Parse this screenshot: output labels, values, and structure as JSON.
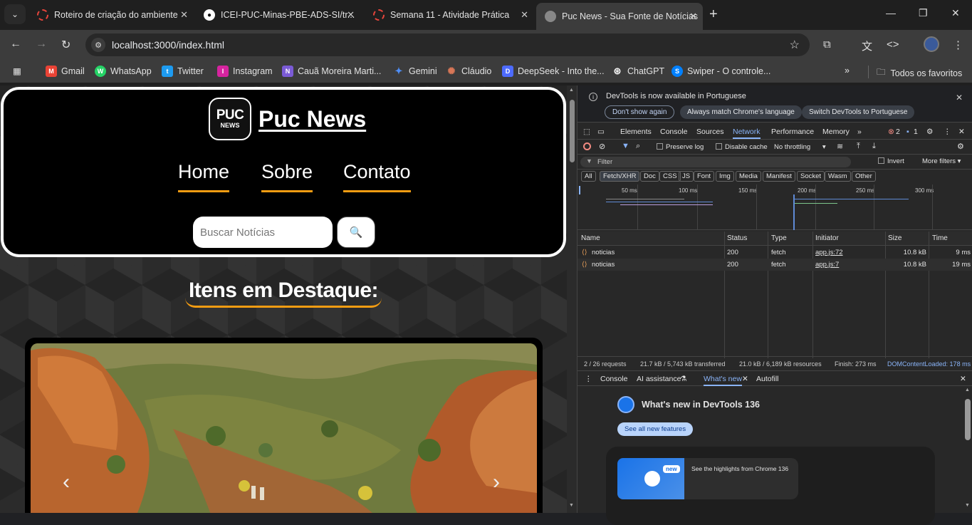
{
  "tabs": [
    {
      "title": "Roteiro de criação do ambiente",
      "icon": "loading-ring-icon"
    },
    {
      "title": "ICEI-PUC-Minas-PBE-ADS-SI/tr...",
      "icon": "github-icon"
    },
    {
      "title": "Semana 11 - Atividade Prática",
      "icon": "loading-ring-icon"
    },
    {
      "title": "Puc News - Sua Fonte de Notícias",
      "icon": "globe-icon",
      "active": true
    }
  ],
  "address_bar": {
    "url": "localhost:3000/index.html"
  },
  "bookmarks": [
    {
      "label": "Gmail",
      "color": "#ea4335",
      "glyph": "M"
    },
    {
      "label": "WhatsApp",
      "color": "#25d366",
      "glyph": "W"
    },
    {
      "label": "Twitter",
      "color": "#1d9bf0",
      "glyph": "t"
    },
    {
      "label": "Instagram",
      "color": "#d6249f",
      "glyph": "I"
    },
    {
      "label": "Cauã Moreira Marti...",
      "color": "#7b5bd6",
      "glyph": "N"
    },
    {
      "label": "Gemini",
      "color": "#4f8ff7",
      "glyph": "✦"
    },
    {
      "label": "Cláudio",
      "color": "#d97757",
      "glyph": "✺"
    },
    {
      "label": "DeepSeek - Into the...",
      "color": "#4d6bfe",
      "glyph": "D"
    },
    {
      "label": "ChatGPT",
      "color": "#555555",
      "glyph": "⊛"
    },
    {
      "label": "Swiper - O controle...",
      "color": "#0080ff",
      "glyph": "S"
    }
  ],
  "all_bookmarks_label": "Todos os favoritos",
  "site": {
    "logo_line1": "PUC",
    "logo_line2": "NEWS",
    "title": "Puc News",
    "nav": [
      "Home",
      "Sobre",
      "Contato"
    ],
    "search_placeholder": "Buscar Notícias",
    "featured_title": "Itens em Destaque:",
    "accent_color": "#f39c12"
  },
  "devtools": {
    "info_message": "DevTools is now available in Portuguese",
    "info_buttons": [
      "Don't show again",
      "Always match Chrome's language",
      "Switch DevTools to Portuguese"
    ],
    "panels": [
      "Elements",
      "Console",
      "Sources",
      "Network",
      "Performance",
      "Memory"
    ],
    "active_panel": "Network",
    "error_count": "2",
    "message_count": "1",
    "preserve_log": "Preserve log",
    "disable_cache": "Disable cache",
    "throttling": "No throttling",
    "filter_placeholder": "Filter",
    "invert": "Invert",
    "more_filters": "More filters",
    "type_filters": [
      "All",
      "Fetch/XHR",
      "Doc",
      "CSS",
      "JS",
      "Font",
      "Img",
      "Media",
      "Manifest",
      "Socket",
      "Wasm",
      "Other"
    ],
    "selected_type": "Fetch/XHR",
    "timeline_ticks": [
      "50 ms",
      "100 ms",
      "150 ms",
      "200 ms",
      "250 ms",
      "300 ms"
    ],
    "columns": [
      "Name",
      "Status",
      "Type",
      "Initiator",
      "Size",
      "Time"
    ],
    "requests": [
      {
        "name": "noticias",
        "status": "200",
        "type": "fetch",
        "initiator": "app.js:72",
        "size": "10.8 kB",
        "time": "9 ms"
      },
      {
        "name": "noticias",
        "status": "200",
        "type": "fetch",
        "initiator": "app.js:7",
        "size": "10.8 kB",
        "time": "19 ms"
      }
    ],
    "status_summary": [
      "2 / 26 requests",
      "21.7 kB / 5,743 kB transferred",
      "21.0 kB / 6,189 kB resources",
      "Finish: 273 ms",
      "DOMContentLoaded: 178 ms"
    ],
    "drawer_tabs": [
      "Console",
      "AI assistance",
      "What's new",
      "Autofill"
    ],
    "whats_new_title": "What's new in DevTools 136",
    "see_all_label": "See all new features",
    "new_badge": "new",
    "highlights_text": "See the highlights from Chrome 136"
  }
}
